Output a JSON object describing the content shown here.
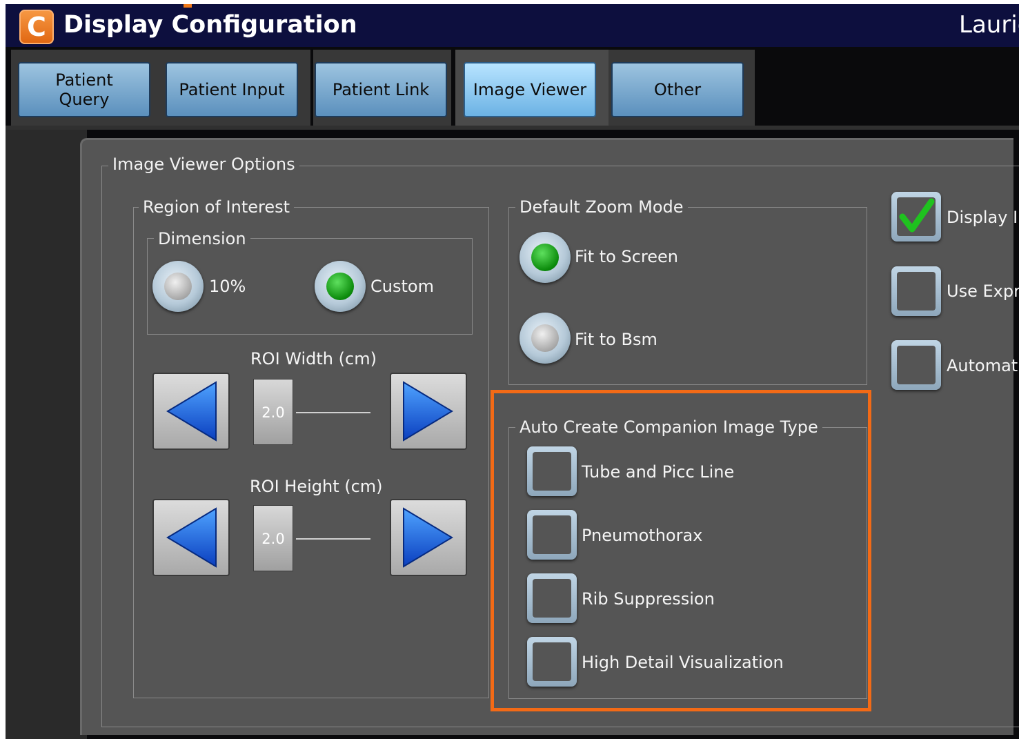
{
  "window": {
    "title": "Display Configuration",
    "user": "Laurie",
    "logo_letter": "C",
    "accent_color": "#f36a16"
  },
  "tabs": [
    {
      "label": "Patient\nQuery",
      "active": false
    },
    {
      "label": "Patient Input",
      "active": false
    },
    {
      "label": "Patient Link",
      "active": false
    },
    {
      "label": "Image Viewer",
      "active": true
    },
    {
      "label": "Other",
      "active": false
    }
  ],
  "panel": {
    "title": "Image Viewer Options",
    "roi": {
      "title": "Region of Interest",
      "dimension": {
        "title": "Dimension",
        "options": [
          {
            "label": "10%",
            "selected": false
          },
          {
            "label": "Custom",
            "selected": true
          }
        ]
      },
      "width": {
        "label": "ROI Width (cm)",
        "value": "2.0"
      },
      "height": {
        "label": "ROI Height (cm)",
        "value": "2.0"
      }
    },
    "zoom": {
      "title": "Default Zoom Mode",
      "options": [
        {
          "label": "Fit to Screen",
          "selected": true
        },
        {
          "label": "Fit to Bsm",
          "selected": false
        }
      ]
    },
    "companion": {
      "title": "Auto Create Companion Image Type",
      "options": [
        {
          "label": "Tube and Picc Line",
          "checked": false
        },
        {
          "label": "Pneumothorax",
          "checked": false
        },
        {
          "label": "Rib Suppression",
          "checked": false
        },
        {
          "label": "High Detail Visualization",
          "checked": false
        }
      ]
    },
    "right_options": [
      {
        "label": "Display I",
        "checked": true
      },
      {
        "label": "Use Expr",
        "checked": false
      },
      {
        "label": "Automati",
        "checked": false
      }
    ]
  }
}
